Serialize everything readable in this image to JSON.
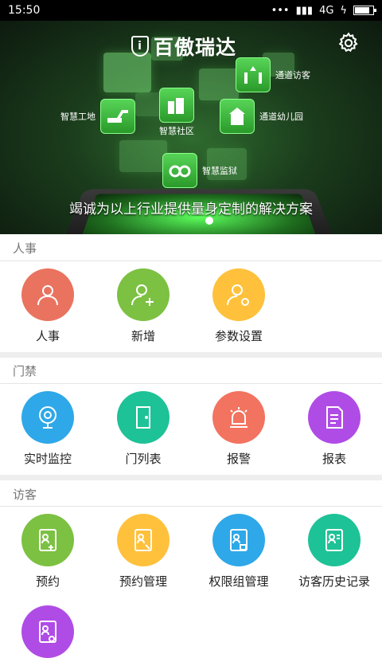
{
  "status_bar": {
    "time": "15:50",
    "dots": "•••",
    "network": "4G",
    "battery_level": 0.8,
    "bolt": "ϟ"
  },
  "banner": {
    "logo_text": "百傲瑞达",
    "logo_mark": "i",
    "features": {
      "construction": "智慧工地",
      "community": "智慧社区",
      "visitor": "通道访客",
      "kindergarten": "通道幼儿园",
      "prison": "智慧监狱"
    },
    "slogan": "竭诚为以上行业提供量身定制的解决方案"
  },
  "sections": {
    "hr": {
      "title": "人事",
      "items": [
        "人事",
        "新增",
        "参数设置"
      ]
    },
    "access": {
      "title": "门禁",
      "items": [
        "实时监控",
        "门列表",
        "报警",
        "报表"
      ]
    },
    "visitor": {
      "title": "访客",
      "items": [
        "预约",
        "预约管理",
        "权限组管理",
        "访客历史记录"
      ]
    }
  },
  "colors": {
    "red": "#e9735f",
    "green": "#7cc142",
    "yellow": "#ffc13c",
    "blue": "#2ea8e8",
    "teal": "#1ec297",
    "purple": "#b04ce6",
    "red2": "#f2735f"
  }
}
